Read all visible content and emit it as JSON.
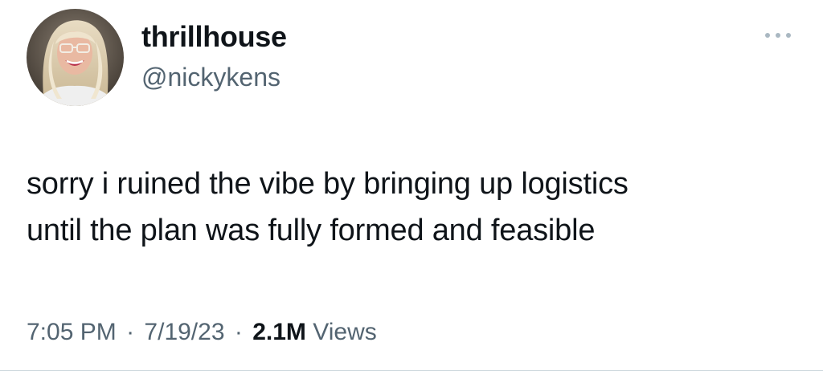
{
  "author": {
    "display_name": "thrillhouse",
    "handle": "@nickykens"
  },
  "tweet": {
    "text_lines": [
      "sorry i ruined the vibe by bringing up logistics",
      "until the plan was fully formed and feasible"
    ]
  },
  "meta": {
    "time": "7:05 PM",
    "separator": "·",
    "date": "7/19/23",
    "views_count": "2.1M",
    "views_label": "Views"
  },
  "icons": {
    "more": "more-horizontal-icon",
    "avatar": "profile-photo"
  },
  "colors": {
    "text_primary": "#0f1419",
    "text_secondary": "#536471",
    "more_icon": "#aab8c2",
    "divider": "#cfd9de"
  }
}
